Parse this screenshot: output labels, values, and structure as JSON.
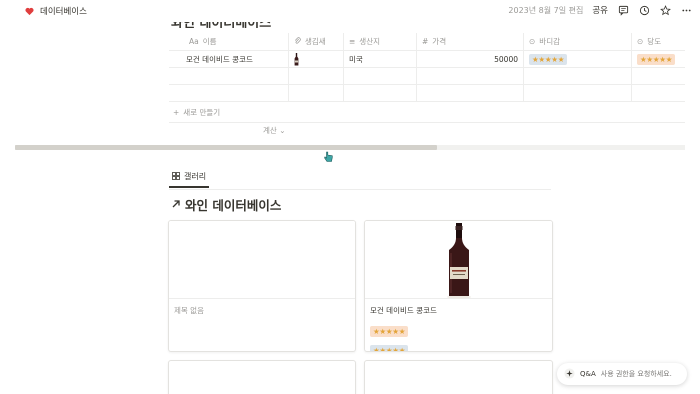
{
  "topbar": {
    "breadcrumb": "데이터베이스",
    "edited": "2023년 8월 7일 편집",
    "share": "공유"
  },
  "table": {
    "title": "와인 데이터베이스",
    "headers": {
      "name": "이름",
      "image": "생김새",
      "origin": "생산지",
      "price": "가격",
      "body": "바디감",
      "sweet": "당도"
    },
    "header_icons": {
      "name": "Aa",
      "image": "📎",
      "origin": "≡",
      "price": "#",
      "body": "⊙",
      "sweet": "⊙"
    },
    "rows": [
      {
        "name": "모건 데이비드 콩코드",
        "origin": "미국",
        "price": "50000",
        "body": "★★★★★",
        "sweet": "★★★★★"
      }
    ],
    "new_row": "새로 만들기",
    "calc": "계산"
  },
  "scrollbar": {
    "position": 0.63
  },
  "gallery": {
    "tab": "갤러리",
    "title": "와인 데이터베이스",
    "cards": [
      {
        "label": "제목 없음"
      },
      {
        "label": "모건 데이비드 콩코드",
        "rating1": "★★★★★",
        "rating2": "★★★★★"
      }
    ]
  },
  "qa": {
    "label": "Q&A",
    "note": "사용 권한을 요청하세요."
  },
  "colors": {
    "heart": "#e03e3e",
    "star": "#e3a53a",
    "chip_blue": "#dbe4ec",
    "chip_orange": "#fadec9",
    "cursor": "#3ea6a6"
  }
}
